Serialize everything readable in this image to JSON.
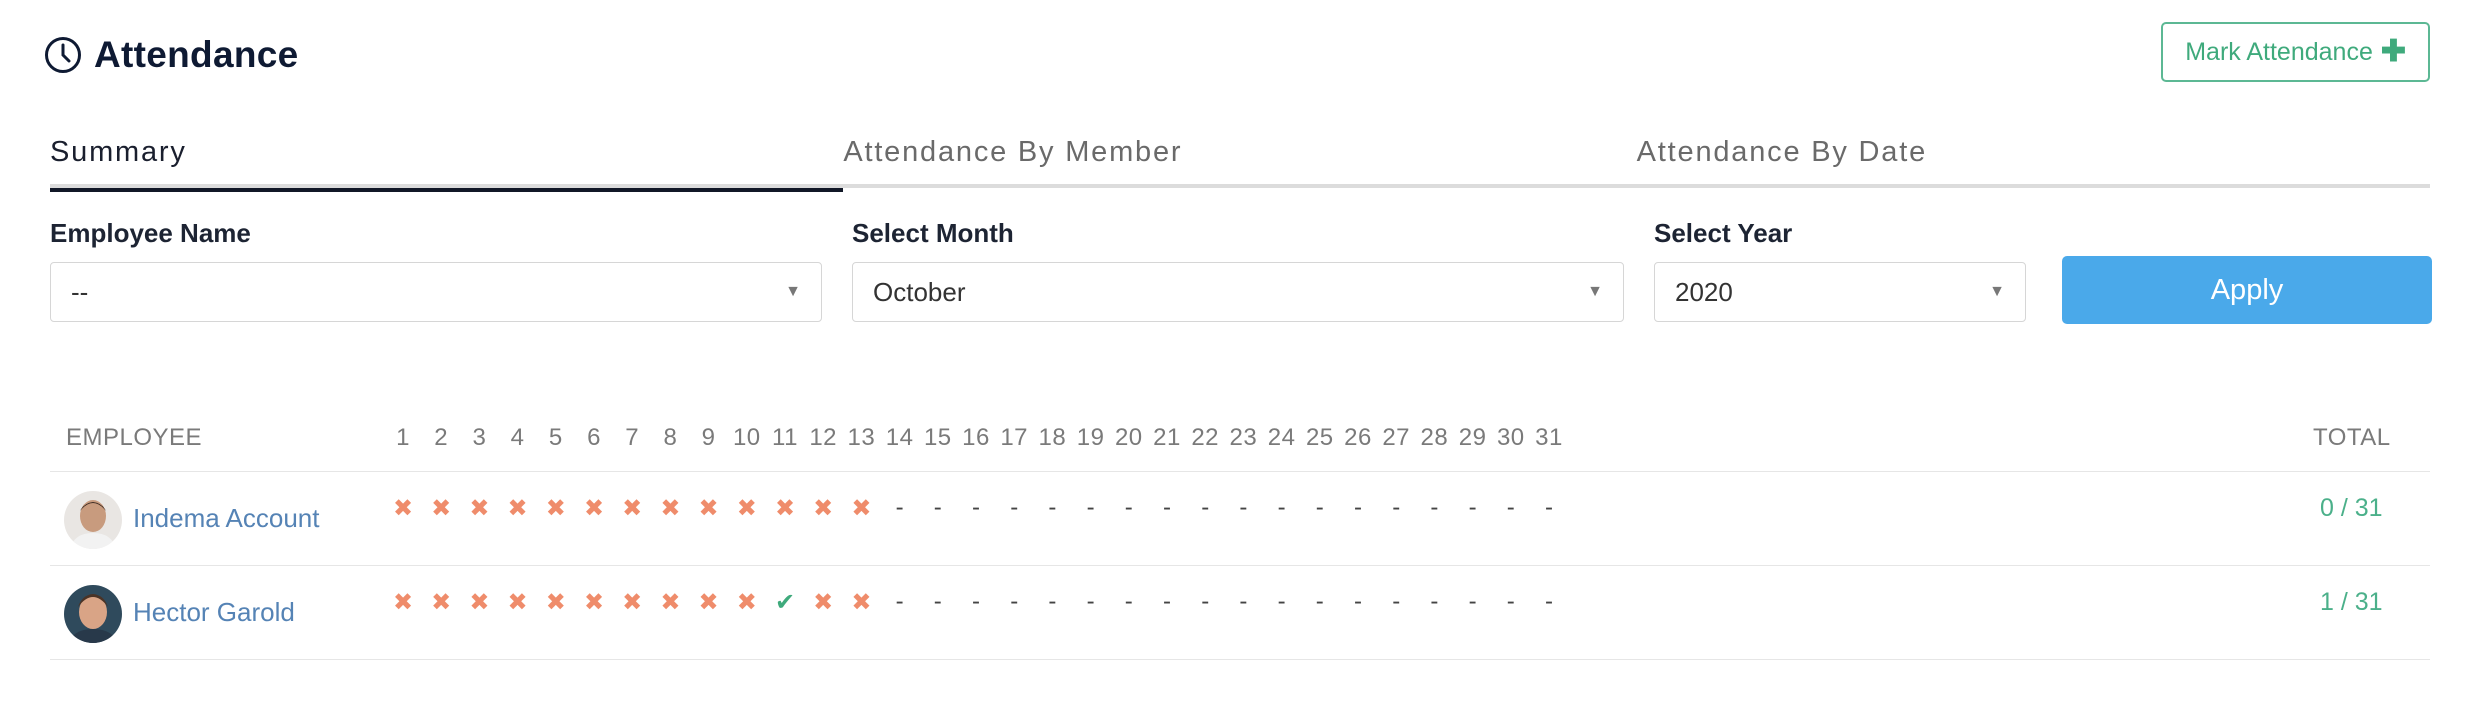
{
  "header": {
    "title": "Attendance",
    "mark_button_label": "Mark Attendance",
    "mark_button_icon": "plus-icon",
    "title_icon": "clock-icon"
  },
  "tabs": [
    {
      "label": "Summary",
      "active": true
    },
    {
      "label": "Attendance By Member",
      "active": false
    },
    {
      "label": "Attendance By Date",
      "active": false
    }
  ],
  "filters": {
    "employee": {
      "label": "Employee Name",
      "value": "--"
    },
    "month": {
      "label": "Select Month",
      "value": "October"
    },
    "year": {
      "label": "Select Year",
      "value": "2020"
    },
    "apply_label": "Apply"
  },
  "table": {
    "employee_header": "EMPLOYEE",
    "total_header": "TOTAL",
    "days": [
      "1",
      "2",
      "3",
      "4",
      "5",
      "6",
      "7",
      "8",
      "9",
      "10",
      "11",
      "12",
      "13",
      "14",
      "15",
      "16",
      "17",
      "18",
      "19",
      "20",
      "21",
      "22",
      "23",
      "24",
      "25",
      "26",
      "27",
      "28",
      "29",
      "30",
      "31"
    ],
    "rows": [
      {
        "name": "Indema Account",
        "marks": [
          "absent",
          "absent",
          "absent",
          "absent",
          "absent",
          "absent",
          "absent",
          "absent",
          "absent",
          "absent",
          "absent",
          "absent",
          "absent",
          "none",
          "none",
          "none",
          "none",
          "none",
          "none",
          "none",
          "none",
          "none",
          "none",
          "none",
          "none",
          "none",
          "none",
          "none",
          "none",
          "none",
          "none"
        ],
        "total": "0 / 31"
      },
      {
        "name": "Hector Garold",
        "marks": [
          "absent",
          "absent",
          "absent",
          "absent",
          "absent",
          "absent",
          "absent",
          "absent",
          "absent",
          "absent",
          "present",
          "absent",
          "absent",
          "none",
          "none",
          "none",
          "none",
          "none",
          "none",
          "none",
          "none",
          "none",
          "none",
          "none",
          "none",
          "none",
          "none",
          "none",
          "none",
          "none",
          "none"
        ],
        "total": "1 / 31"
      }
    ]
  },
  "colors": {
    "accent_green": "#3faa7c",
    "absent": "#ef8c6b",
    "apply_blue": "#4aa9ea",
    "link": "#5583b5"
  }
}
